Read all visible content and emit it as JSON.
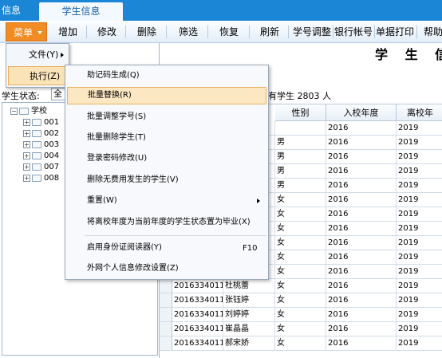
{
  "tabs": {
    "previous": "信息",
    "active": "学生信息"
  },
  "toolbar": {
    "menu": "菜单",
    "buttons": [
      "增加",
      "修改",
      "删除",
      "筛选",
      "恢复",
      "刷新",
      "学号调整",
      "银行帐号",
      "单据打印",
      "帮助"
    ]
  },
  "page": {
    "title": "学 生 信",
    "status_label": "学生状态:",
    "status_value": "全",
    "count_text": "有学生 2803 人"
  },
  "tree": {
    "root": "学校",
    "children": [
      "001",
      "002",
      "003",
      "004",
      "007",
      "008"
    ]
  },
  "grid": {
    "columns": [
      "性别",
      "入校年度",
      "离校年"
    ],
    "rows": [
      {
        "id": "",
        "name": "",
        "gender": "",
        "entry": "2016",
        "leave": "2019"
      },
      {
        "id": "",
        "name": "",
        "gender": "男",
        "entry": "2016",
        "leave": "2019"
      },
      {
        "id": "",
        "name": "",
        "gender": "男",
        "entry": "2016",
        "leave": "2019"
      },
      {
        "id": "",
        "name": "",
        "gender": "男",
        "entry": "2016",
        "leave": "2019"
      },
      {
        "id": "",
        "name": "",
        "gender": "男",
        "entry": "2016",
        "leave": "2019"
      },
      {
        "id": "",
        "name": "",
        "gender": "女",
        "entry": "2016",
        "leave": "2019"
      },
      {
        "id": "",
        "name": "",
        "gender": "女",
        "entry": "2016",
        "leave": "2019"
      },
      {
        "id": "",
        "name": "",
        "gender": "女",
        "entry": "2016",
        "leave": "2019"
      },
      {
        "id": "",
        "name": "",
        "gender": "女",
        "entry": "2016",
        "leave": "2019"
      },
      {
        "id": "",
        "name": "",
        "gender": "女",
        "entry": "2016",
        "leave": "2019"
      },
      {
        "id": "",
        "name": "",
        "gender": "女",
        "entry": "2016",
        "leave": "2019"
      },
      {
        "id": "20163340111",
        "name": "杜桃蕾",
        "gender": "女",
        "entry": "2016",
        "leave": "2019"
      },
      {
        "id": "20163340112",
        "name": "张钰婷",
        "gender": "女",
        "entry": "2016",
        "leave": "2019"
      },
      {
        "id": "20163340113",
        "name": "刘婷婷",
        "gender": "女",
        "entry": "2016",
        "leave": "2019"
      },
      {
        "id": "20163340114",
        "name": "崔晶晶",
        "gender": "女",
        "entry": "2016",
        "leave": "2019"
      },
      {
        "id": "20163340115",
        "name": "郝宋娇",
        "gender": "女",
        "entry": "2016",
        "leave": "2019"
      }
    ]
  },
  "menu_level1": {
    "items": [
      "文件(Y)",
      "执行(Z)"
    ]
  },
  "menu_level2": {
    "items": [
      "助记码生成(Q)",
      "批量替换(R)",
      "批量调整学号(S)",
      "批量删除学生(T)",
      "登录密码修改(U)",
      "删除无费用发生的学生(V)",
      "重置(W)",
      "将离校年度为当前年度的学生状态置为毕业(X)",
      "启用身份证阅读器(Y)",
      "外网个人信息修改设置(Z)"
    ],
    "shortcut": "F10"
  },
  "colors": {
    "tab_bar": "#1b86d6",
    "menu_button": "#f18b23",
    "highlight": "#fbe7c2"
  }
}
